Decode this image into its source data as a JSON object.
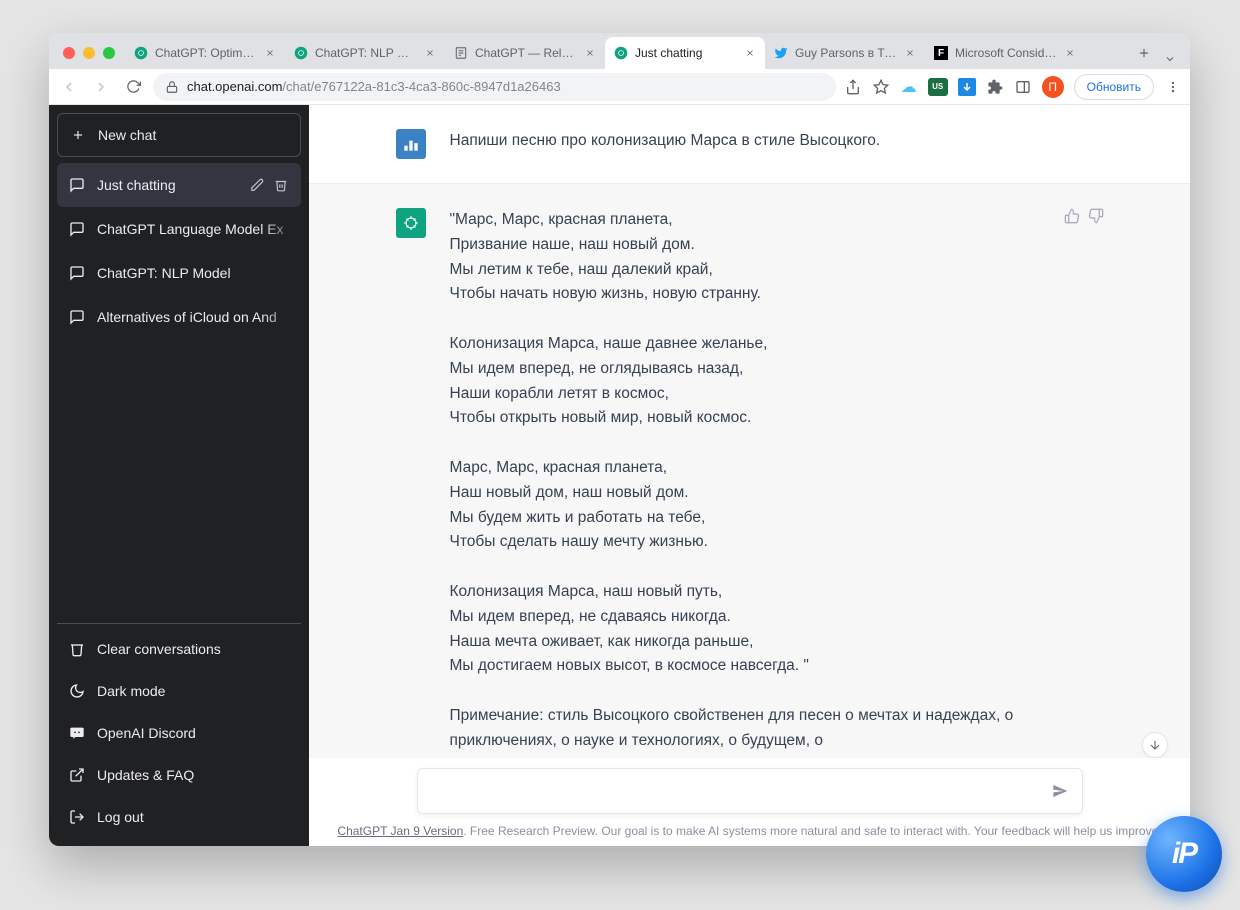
{
  "browser": {
    "tabs": [
      {
        "title": "ChatGPT: Optimizing",
        "favicon": "chatgpt"
      },
      {
        "title": "ChatGPT: NLP Model",
        "favicon": "chatgpt"
      },
      {
        "title": "ChatGPT — Release",
        "favicon": "article"
      },
      {
        "title": "Just chatting",
        "favicon": "chatgpt",
        "active": true
      },
      {
        "title": "Guy Parsons в Твит",
        "favicon": "twitter"
      },
      {
        "title": "Microsoft Considers",
        "favicon": "f-square"
      }
    ],
    "url_domain": "chat.openai.com",
    "url_path": "/chat/e767122a-81c3-4ca3-860c-8947d1a26463",
    "update_label": "Обновить",
    "profile_initial": "П"
  },
  "sidebar": {
    "new_chat_label": "New chat",
    "chats": [
      {
        "title": "Just chatting",
        "active": true
      },
      {
        "title": "ChatGPT Language Model Ex"
      },
      {
        "title": "ChatGPT: NLP Model"
      },
      {
        "title": "Alternatives of iCloud on And"
      }
    ],
    "bottom": [
      {
        "icon": "trash",
        "label": "Clear conversations"
      },
      {
        "icon": "moon",
        "label": "Dark mode"
      },
      {
        "icon": "discord",
        "label": "OpenAI Discord"
      },
      {
        "icon": "external",
        "label": "Updates & FAQ"
      },
      {
        "icon": "logout",
        "label": "Log out"
      }
    ]
  },
  "conversation": {
    "user_prompt": "Напиши песню про колонизацию Марса в стиле Высоцкого.",
    "assistant_reply": "\"Марс, Марс, красная планета,\nПризвание наше, наш новый дом.\nМы летим к тебе, наш далекий край,\nЧтобы начать новую жизнь, новую странну.\n\nКолонизация Марса, наше давнее желанье,\nМы идем вперед, не оглядываясь назад,\nНаши корабли летят в космос,\nЧтобы открыть новый мир, новый космос.\n\nМарс, Марс, красная планета,\nНаш новый дом, наш новый дом.\nМы будем жить и работать на тебе,\nЧтобы сделать нашу мечту жизнью.\n\nКолонизация Марса, наш новый путь,\nМы идем вперед, не сдаваясь никогда.\nНаша мечта оживает, как никогда раньше,\nМы достигаем новых высот, в космосе навсегда. \"\n\nПримечание: стиль Высоцкого свойственен для песен о мечтах и надеждах, о приключениях, о науке и технологиях, о будущем, о"
  },
  "composer": {
    "placeholder": ""
  },
  "footer": {
    "link_text": "ChatGPT Jan 9 Version",
    "rest": ". Free Research Preview. Our goal is to make AI systems more natural and safe to interact with. Your feedback will help us improve."
  },
  "badge": "iP"
}
